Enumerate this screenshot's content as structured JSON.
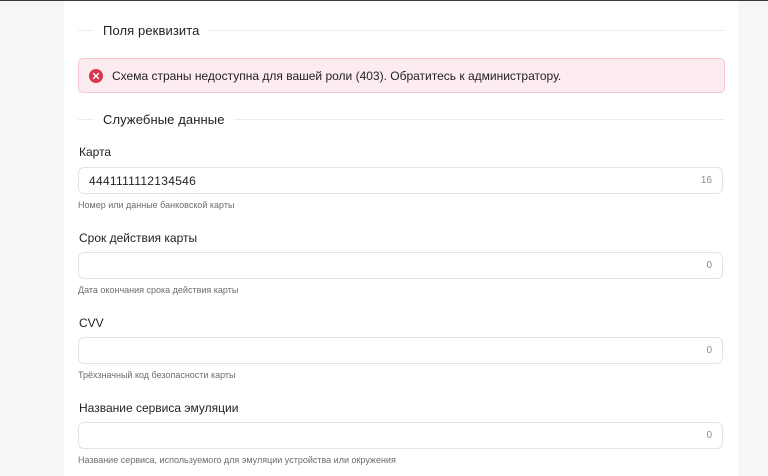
{
  "sections": {
    "requisite_fields": {
      "title": "Поля реквизита"
    },
    "service_data": {
      "title": "Служебные данные"
    }
  },
  "alert": {
    "icon": "error-circle-icon",
    "text": "Схема страны недоступна для вашей роли (403). Обратитесь к администратору.",
    "color": "#d93650"
  },
  "fields": [
    {
      "label": "Карта",
      "value": "4441111112134546",
      "counter": "16",
      "hint": "Номер или данные банковской карты"
    },
    {
      "label": "Срок действия карты",
      "value": "",
      "counter": "0",
      "hint": "Дата окончания срока действия карты"
    },
    {
      "label": "CVV",
      "value": "",
      "counter": "0",
      "hint": "Трёхзначный код безопасности карты"
    },
    {
      "label": "Название сервиса эмуляции",
      "value": "",
      "counter": "0",
      "hint": "Название сервиса, используемого для эмуляции устройства или окружения"
    }
  ]
}
